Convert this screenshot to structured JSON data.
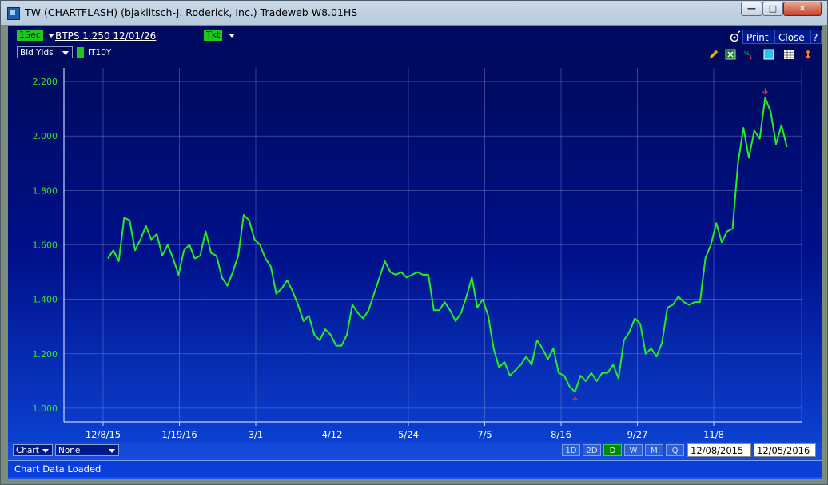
{
  "window": {
    "title": "TW  (CHARTFLASH) (bjaklitsch-J. Roderick, Inc.) Tradeweb W8.01HS"
  },
  "toolbar": {
    "interval": "1Sec",
    "instrument": "BTPS  1.250 12/01/26",
    "ticket": "Tkt",
    "print": "Print",
    "close": "Close",
    "help": "?",
    "field_select": "Bid Ylds",
    "series_label": "IT10Y"
  },
  "icons": [
    "settings-icon",
    "pencil-icon",
    "excel-icon",
    "percent-icon",
    "color-square-icon",
    "grid-icon",
    "vertical-arrows-icon"
  ],
  "chart_data": {
    "type": "line",
    "ylim": [
      0.95,
      2.25
    ],
    "yticks": [
      "1.000",
      "1.200",
      "1.400",
      "1.600",
      "1.800",
      "2.000",
      "2.200"
    ],
    "ytick_values": [
      1.0,
      1.2,
      1.4,
      1.6,
      1.8,
      2.0,
      2.2
    ],
    "xticks": [
      "12/8/15",
      "1/19/16",
      "3/1",
      "4/12",
      "5/24",
      "7/5",
      "8/16",
      "9/27",
      "11/8"
    ],
    "x_count": 252,
    "grid": true,
    "line_color": "#22ee22",
    "series": [
      {
        "name": "IT10Y",
        "x": [
          0,
          2,
          4,
          6,
          8,
          10,
          12,
          14,
          16,
          18,
          20,
          22,
          24,
          26,
          28,
          30,
          32,
          34,
          36,
          38,
          40,
          42,
          44,
          46,
          48,
          50,
          52,
          54,
          56,
          58,
          60,
          62,
          64,
          66,
          68,
          70,
          72,
          74,
          76,
          78,
          80,
          82,
          84,
          86,
          88,
          90,
          92,
          94,
          96,
          98,
          100,
          102,
          104,
          106,
          108,
          110,
          112,
          114,
          116,
          118,
          120,
          122,
          124,
          126,
          128,
          130,
          132,
          134,
          136,
          138,
          140,
          142,
          144,
          146,
          148,
          150,
          152,
          154,
          156,
          158,
          160,
          162,
          164,
          166,
          168,
          170,
          172,
          174,
          176,
          178,
          180,
          182,
          184,
          186,
          188,
          190,
          192,
          194,
          196,
          198,
          200,
          202,
          204,
          206,
          208,
          210,
          212,
          214,
          216,
          218,
          220,
          222,
          224,
          226,
          228,
          230,
          232,
          234,
          236,
          238,
          240,
          242,
          244,
          246,
          248,
          250
        ],
        "values": [
          1.55,
          1.58,
          1.54,
          1.7,
          1.69,
          1.58,
          1.62,
          1.67,
          1.62,
          1.64,
          1.56,
          1.6,
          1.55,
          1.49,
          1.58,
          1.6,
          1.55,
          1.56,
          1.65,
          1.57,
          1.56,
          1.48,
          1.45,
          1.5,
          1.56,
          1.71,
          1.69,
          1.62,
          1.6,
          1.55,
          1.52,
          1.42,
          1.44,
          1.47,
          1.43,
          1.38,
          1.32,
          1.34,
          1.27,
          1.25,
          1.29,
          1.27,
          1.23,
          1.23,
          1.27,
          1.38,
          1.35,
          1.33,
          1.36,
          1.42,
          1.48,
          1.54,
          1.5,
          1.49,
          1.5,
          1.48,
          1.49,
          1.5,
          1.49,
          1.49,
          1.36,
          1.36,
          1.39,
          1.36,
          1.32,
          1.35,
          1.41,
          1.48,
          1.37,
          1.4,
          1.34,
          1.22,
          1.15,
          1.17,
          1.12,
          1.14,
          1.16,
          1.19,
          1.16,
          1.25,
          1.22,
          1.18,
          1.22,
          1.13,
          1.12,
          1.08,
          1.06,
          1.12,
          1.1,
          1.13,
          1.1,
          1.13,
          1.13,
          1.16,
          1.11,
          1.25,
          1.28,
          1.33,
          1.31,
          1.2,
          1.22,
          1.19,
          1.24,
          1.37,
          1.38,
          1.41,
          1.39,
          1.38,
          1.39,
          1.39,
          1.55,
          1.6,
          1.68,
          1.61,
          1.65,
          1.66,
          1.9,
          2.03,
          1.92,
          2.02,
          1.99,
          2.14,
          2.09,
          1.97,
          2.04,
          1.96
        ]
      }
    ]
  },
  "range_buttons": [
    "1D",
    "2D",
    "D",
    "W",
    "M",
    "Q"
  ],
  "range_active": "D",
  "bottom": {
    "chart_select": "Chart",
    "study_select": "None",
    "start_date": "12/08/2015",
    "end_date": "12/05/2016"
  },
  "status": {
    "message": "Chart Data Loaded"
  },
  "colors": {
    "background_top": "#000a5e",
    "background_bottom": "#1a55e8",
    "accent_green": "#1ec81e",
    "marker_red": "#ff3030"
  }
}
